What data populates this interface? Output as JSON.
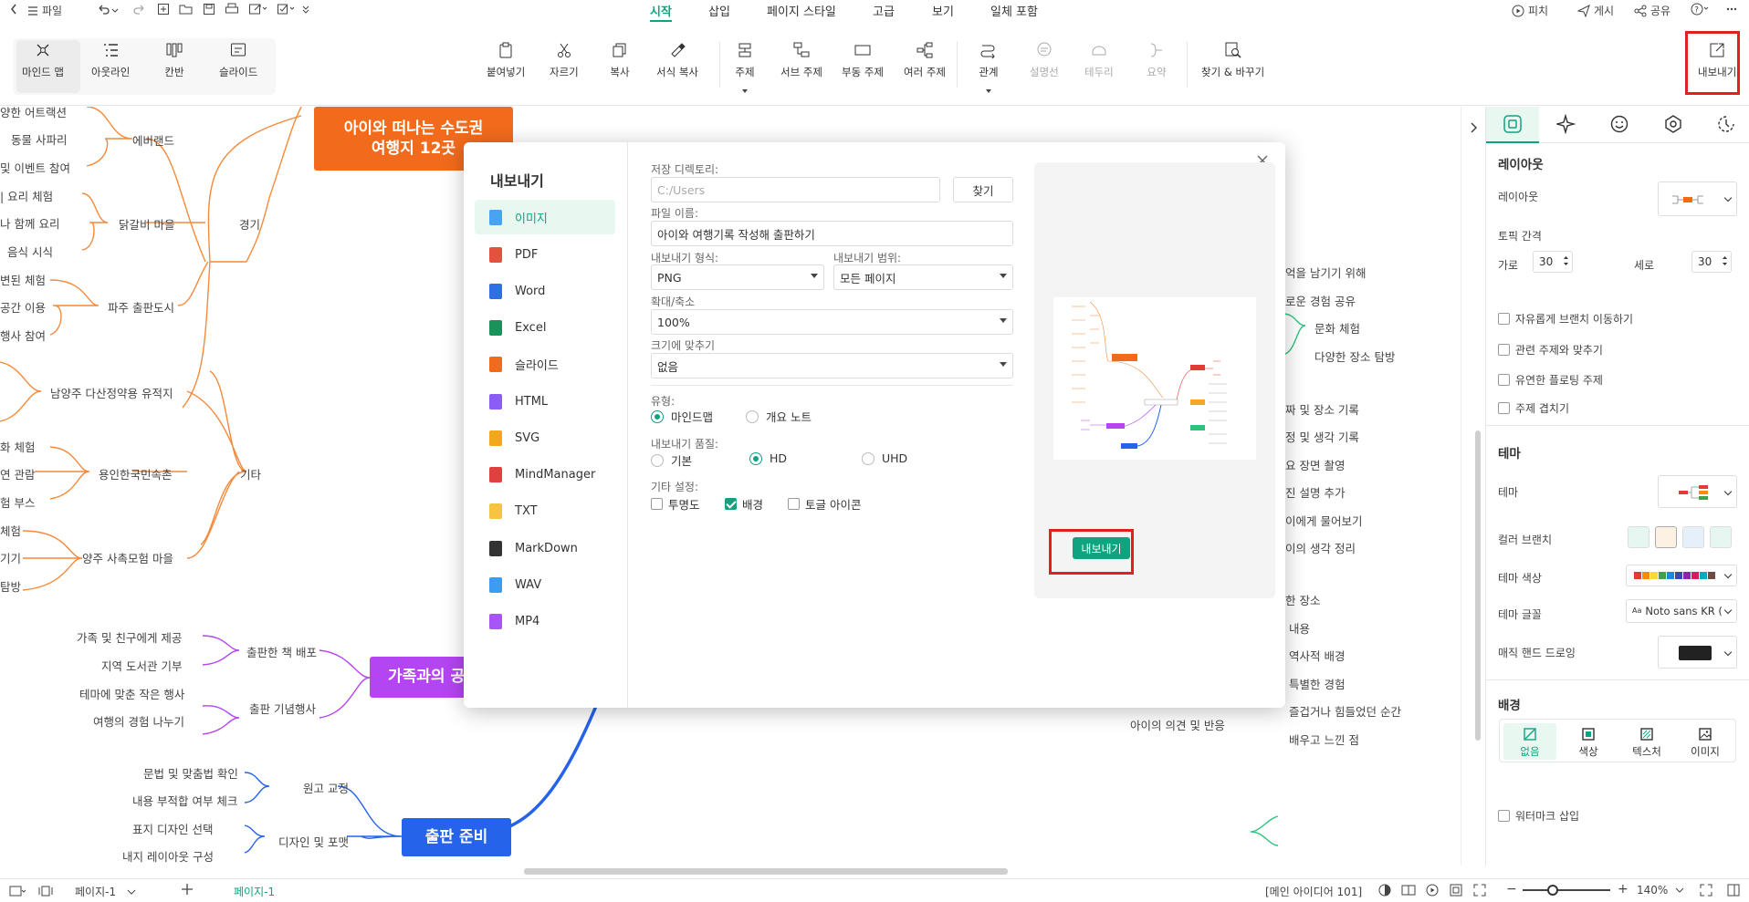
{
  "topbar": {
    "file_label": "파일",
    "menu_tabs": [
      "시작",
      "삽입",
      "페이지 스타일",
      "고급",
      "보기",
      "일체 포함"
    ],
    "active_tab": "시작",
    "right_items": [
      "피치",
      "게시",
      "공유"
    ]
  },
  "ribbon": {
    "views": [
      "마인드 맵",
      "아웃라인",
      "칸반",
      "슬라이드"
    ],
    "tools": [
      "붙여넣기",
      "자르기",
      "복사",
      "서식 복사",
      "주제",
      "서브 주제",
      "부동 주제",
      "여러 주제",
      "관계",
      "설명선",
      "테두리",
      "요약",
      "찾기 & 바꾸기"
    ],
    "export_label": "내보내기"
  },
  "canvas": {
    "main_topic": "아이와 떠나는 수도권\n여행지 12곳",
    "family_topic": "가족과의 공",
    "publish_topic": "출판 준비",
    "left_nodes": [
      "양한 어트랙션",
      "동물 사파리",
      "및 이벤트 참여",
      "에버랜드",
      "| 요리 체험",
      "나 함께 요리",
      "음식 시식",
      "닭갈비 마을",
      "경기",
      "변된 체험",
      "공간 이용",
      "행사 참여",
      "파주 출판도시",
      "남양주 다산정약용 유적지",
      "화 체험",
      "연 관람",
      "험 부스",
      "용인한국민속촌",
      "기타",
      "체험",
      "기기",
      "탐방",
      "양주 사촉모험 마을",
      "가족 및 친구에게 제공",
      "지역 도서관 기부",
      "출판한 책 배포",
      "테마에 맞춘 작은 행사",
      "여행의 경험 나누기",
      "출판 기념행사",
      "문법 및 맞춤법 확인",
      "내용 부적합 여부 체크",
      "원고 교정",
      "표지 디자인 선택",
      "내지 레이아웃 구성",
      "디자인 및 포맷"
    ],
    "right_nodes": [
      "억을 남기기 위해",
      "로운 경험 공유",
      "문화 체험",
      "다양한 장소 탐방",
      "짜 및 장소 기록",
      "정 및 생각 기록",
      "요 장면 촬영",
      "진 설명 추가",
      "이에게 물어보기",
      "이의 생각 정리",
      "한 장소",
      "내용",
      "역사적 배경",
      "특별한 경험",
      "즐겁거나 힘들었던 순간",
      "아이의 의견 및 반응",
      "배우고 느낀 점"
    ]
  },
  "dialog": {
    "title": "내보내기",
    "formats": [
      "이미지",
      "PDF",
      "Word",
      "Excel",
      "슬라이드",
      "HTML",
      "SVG",
      "MindManager",
      "TXT",
      "MarkDown",
      "WAV",
      "MP4"
    ],
    "active_format": "이미지",
    "dir_label": "저장 디렉토리:",
    "dir_value": "C:/Users",
    "browse_label": "찾기",
    "filename_label": "파일 이름:",
    "filename_value": "아이와 여행기록 작성해 출판하기",
    "format_label": "내보내기 형식:",
    "format_value": "PNG",
    "range_label": "내보내기 범위:",
    "range_value": "모든 페이지",
    "zoom_label": "확대/축소",
    "zoom_value": "100%",
    "fit_label": "크기에 맞추기",
    "fit_value": "없음",
    "type_label": "유형:",
    "type_options": [
      "마인드맵",
      "개요 노트"
    ],
    "type_selected": "마인드맵",
    "quality_label": "내보내기 품질:",
    "quality_options": [
      "기본",
      "HD",
      "UHD"
    ],
    "quality_selected": "HD",
    "other_label": "기타 설정:",
    "other_options": [
      {
        "label": "투명도",
        "checked": false
      },
      {
        "label": "배경",
        "checked": true
      },
      {
        "label": "토글 아이콘",
        "checked": false
      }
    ],
    "export_button": "내보내기"
  },
  "rpanel": {
    "layout_heading": "레이아웃",
    "layout_label": "레이아웃",
    "spacing_label": "토픽 간격",
    "h_label": "가로",
    "h_value": "30",
    "v_label": "세로",
    "v_value": "30",
    "checks": [
      "자유롭게 브랜치 이동하기",
      "관련 주제와 맞추기",
      "유연한 플로팅 주제",
      "주제 겹치기"
    ],
    "theme_heading": "테마",
    "theme_label": "테마",
    "color_branch_label": "컬러 브랜치",
    "theme_color_label": "테마 색상",
    "theme_font_label": "테마 글꼴",
    "theme_font_value": "Noto sans KR (",
    "hand_draw_label": "매직 핸드 드로잉",
    "bg_heading": "배경",
    "bg_options": [
      "없음",
      "색상",
      "텍스처",
      "이미지"
    ],
    "watermark_label": "워터마크 삽입",
    "palette": [
      "#e53935",
      "#fb8c00",
      "#fdd835",
      "#43a047",
      "#1e88e5",
      "#3949ab",
      "#8e24aa",
      "#d81b60",
      "#00acc1",
      "#6d4c41"
    ]
  },
  "status": {
    "page_tab_1": "페이지-1",
    "page_tab_2": "페이지-1",
    "node_info": "[메인 아이디어 101]",
    "zoom": "140%"
  },
  "colors": {
    "accent": "#10a37f",
    "orange": "#f26b1d",
    "purple": "#b445f3",
    "blue": "#2563eb",
    "highlight": "#e02020"
  }
}
